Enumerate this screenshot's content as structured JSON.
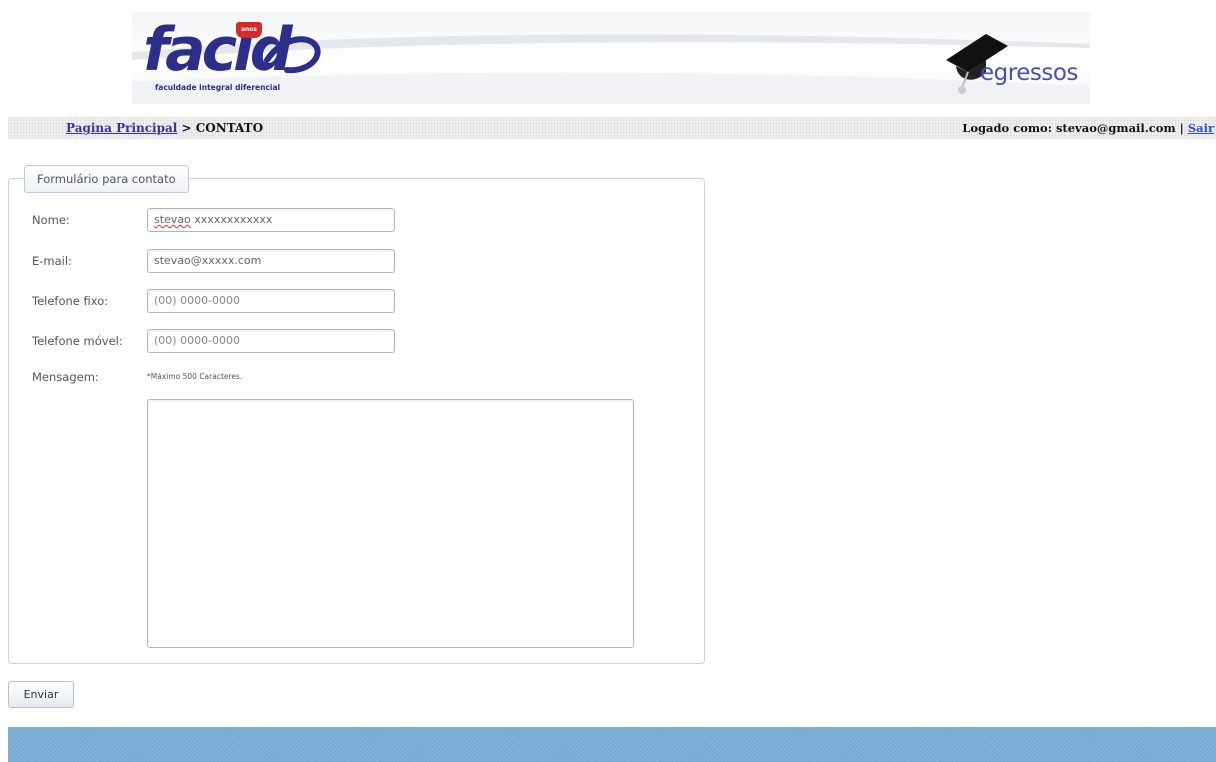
{
  "header": {
    "logo_left": {
      "wordmark": "facid",
      "badge": "anos",
      "tagline": "faculdade integral diferencial"
    },
    "logo_right": {
      "wordmark": "egressos",
      "icon": "graduation-cap-icon"
    }
  },
  "nav": {
    "breadcrumb_link": "Pagina Principal",
    "breadcrumb_separator": " > ",
    "breadcrumb_current": "CONTATO",
    "login_prefix": "Logado como: stevao@gmail.com",
    "login_separator": " | ",
    "logout_link": "Sair"
  },
  "form": {
    "legend": "Formulário para contato",
    "name_label": "Nome:",
    "name_value_underlined": "stevao",
    "name_value_rest": " xxxxxxxxxxxx",
    "email_label": "E-mail:",
    "email_value": "stevao@xxxxx.com",
    "phone_label": "Telefone fixo:",
    "phone_placeholder": "(00) 0000-0000",
    "mobile_label": "Telefone móvel:",
    "mobile_placeholder": "(00) 0000-0000",
    "message_label": "Mensagem:",
    "message_note": "*Máximo 500 Caracteres.",
    "message_value": ""
  },
  "actions": {
    "submit_label": "Enviar"
  },
  "colors": {
    "brand_blue": "#2b2f8a",
    "badge_red": "#d42a2a",
    "footer_blue": "#7aaed6",
    "link_blue": "#2a4fd0"
  }
}
